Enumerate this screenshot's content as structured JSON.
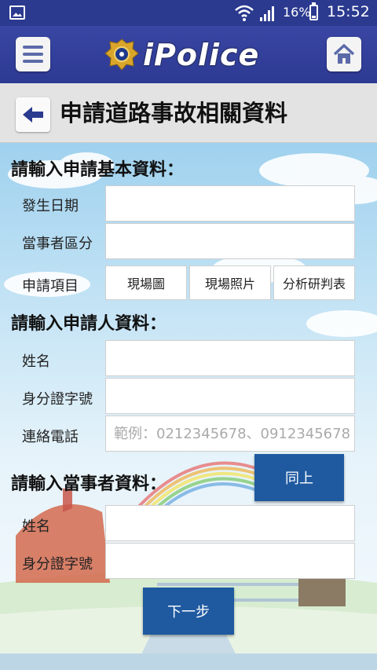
{
  "status_bar": {
    "battery": "16%",
    "time": "15:52"
  },
  "header": {
    "app_name": "iPolice"
  },
  "title_bar": {
    "title": "申請道路事故相關資料"
  },
  "form": {
    "section_basic": {
      "heading": "請輸入申請基本資料：",
      "date_label": "發生日期",
      "party_type_label": "當事者區分",
      "items_label": "申請項目",
      "items": [
        "現場圖",
        "現場照片",
        "分析研判表"
      ]
    },
    "section_applicant": {
      "heading": "請輸入申請人資料：",
      "name_label": "姓名",
      "id_label": "身分證字號",
      "phone_label": "連絡電話",
      "phone_placeholder": "範例：0212345678、0912345678"
    },
    "section_party": {
      "heading": "請輸入當事者資料：",
      "same_button": "同上",
      "name_label": "姓名",
      "id_label": "身分證字號"
    },
    "next_button": "下一步"
  }
}
